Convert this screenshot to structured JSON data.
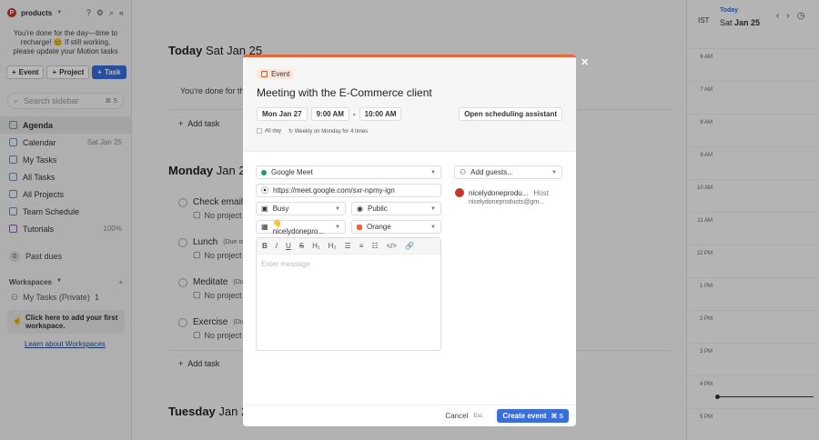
{
  "sidebar": {
    "workspace": "products",
    "message": "You're done for the day—time to recharge! 😊 If still working, please update your Motion tasks",
    "buttons": {
      "event": "Event",
      "project": "Project",
      "task": "Task"
    },
    "search_placeholder": "Search sidebar",
    "search_kbd": "⌘ S",
    "nav": [
      {
        "label": "Agenda"
      },
      {
        "label": "Calendar",
        "right": "Sat Jan 25"
      },
      {
        "label": "My Tasks"
      },
      {
        "label": "All Tasks"
      },
      {
        "label": "All Projects"
      },
      {
        "label": "Team Schedule"
      },
      {
        "label": "Tutorials",
        "right": "100%"
      }
    ],
    "past_dues_count": "0",
    "past_dues": "Past dues",
    "workspaces_label": "Workspaces",
    "my_tasks_private": "My Tasks (Private)",
    "my_tasks_private_count": "1",
    "hint": "Click here to add your first workspace.",
    "learn": "Learn about Workspaces"
  },
  "main": {
    "today_bold": "Today",
    "today_date": "Sat Jan 25",
    "today_msg": "You're done for the",
    "add_task": "Add task",
    "monday_bold": "Monday",
    "monday_date": "Jan 27",
    "tuesday_bold": "Tuesday",
    "tuesday_date": "Jan 28",
    "no_project": "No project",
    "tasks": [
      {
        "name": "Check emails",
        "due": ""
      },
      {
        "name": "Lunch",
        "due": "(Due on"
      },
      {
        "name": "Meditate",
        "due": "(Du"
      },
      {
        "name": "Exercise",
        "due": "(Due"
      }
    ]
  },
  "calendar": {
    "tz": "IST",
    "today_label": "Today",
    "date_day": "Sat",
    "date_rest": "Jan 25",
    "hours": [
      "6 AM",
      "7 AM",
      "8 AM",
      "9 AM",
      "10 AM",
      "11 AM",
      "12 PM",
      "1 PM",
      "2 PM",
      "3 PM",
      "4 PM",
      "5 PM"
    ]
  },
  "modal": {
    "badge": "Event",
    "title": "Meeting with the E-Commerce client",
    "date": "Mon Jan 27",
    "start": "9:00 AM",
    "dash": "-",
    "end": "10:00 AM",
    "open_scheduling": "Open scheduling assistant",
    "all_day": "All day",
    "recurrence": "Weekly on Monday for 4 times",
    "conferencing": "Google Meet",
    "meet_link": "https://meet.google.com/sxr-npmy-ign",
    "busy": "Busy",
    "visibility": "Public",
    "calendar": "👋 nicelydonepro...",
    "color_name": "Orange",
    "color_hex": "#e8663a",
    "editor_placeholder": "Enter message",
    "add_guests": "Add guests...",
    "guest_name": "nicelydoneprodu...",
    "guest_role": "Host",
    "guest_email": "nicelydoneproducts@gm...",
    "cancel": "Cancel",
    "esc": "Esc",
    "create": "Create event",
    "create_kbd": "⌘ S"
  }
}
